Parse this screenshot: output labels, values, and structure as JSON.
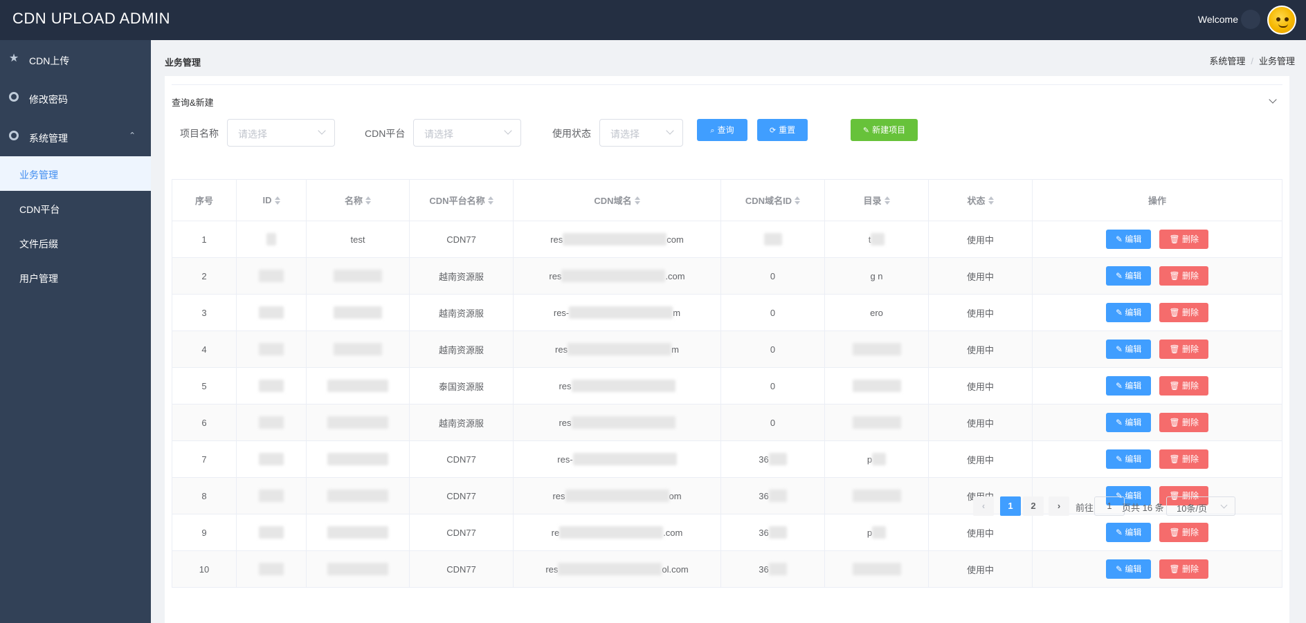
{
  "app": {
    "title": "CDN UPLOAD ADMIN",
    "welcome": "Welcome"
  },
  "sidebar": {
    "items": [
      {
        "label": "CDN上传",
        "icon": "star-icon"
      },
      {
        "label": "修改密码",
        "icon": "settings-icon"
      },
      {
        "label": "系统管理",
        "icon": "settings-icon"
      }
    ],
    "sub_items": [
      {
        "label": "业务管理",
        "active": true
      },
      {
        "label": "CDN平台",
        "active": false
      },
      {
        "label": "文件后缀",
        "active": false
      },
      {
        "label": "用户管理",
        "active": false
      }
    ]
  },
  "page": {
    "title": "业务管理",
    "breadcrumb": [
      "系统管理",
      "/",
      "业务管理"
    ]
  },
  "filter": {
    "panel_title": "查询&新建",
    "fields": [
      {
        "label": "项目名称",
        "placeholder": "请选择"
      },
      {
        "label": "CDN平台",
        "placeholder": "请选择"
      },
      {
        "label": "使用状态",
        "placeholder": "请选择"
      }
    ],
    "buttons": {
      "query": "查询",
      "reset": "重置",
      "create": "新建项目"
    }
  },
  "table": {
    "columns": [
      "序号",
      "ID",
      "名称",
      "CDN平台名称",
      "CDN域名",
      "CDN域名ID",
      "目录",
      "状态",
      "操作"
    ],
    "rows": [
      {
        "no": "1",
        "name": "test",
        "platform": "CDN77",
        "domain_start": "res",
        "domain_end": "com",
        "domain_id": "",
        "dir": "t",
        "status": "使用中"
      },
      {
        "no": "2",
        "name": "",
        "platform": "越南资源服",
        "domain_start": "res",
        "domain_end": ".com",
        "domain_id": "0",
        "dir": "g  n",
        "status": "使用中"
      },
      {
        "no": "3",
        "name": "",
        "platform": "越南资源服",
        "domain_start": "res-",
        "domain_end": "m",
        "domain_id": "0",
        "dir": "ero",
        "status": "使用中"
      },
      {
        "no": "4",
        "name": "",
        "platform": "越南资源服",
        "domain_start": "res",
        "domain_end": "m",
        "domain_id": "0",
        "dir": "",
        "status": "使用中"
      },
      {
        "no": "5",
        "name": "",
        "platform": "泰国资源服",
        "domain_start": "res",
        "domain_end": "",
        "domain_id": "0",
        "dir": "",
        "status": "使用中"
      },
      {
        "no": "6",
        "name": "",
        "platform": "越南资源服",
        "domain_start": "res",
        "domain_end": "",
        "domain_id": "0",
        "dir": "",
        "status": "使用中"
      },
      {
        "no": "7",
        "name": "",
        "platform": "CDN77",
        "domain_start": "res-",
        "domain_end": "",
        "domain_id": "36",
        "dir": "p",
        "status": "使用中"
      },
      {
        "no": "8",
        "name": "",
        "platform": "CDN77",
        "domain_start": "res",
        "domain_end": "om",
        "domain_id": "36",
        "dir": "",
        "status": "使用中"
      },
      {
        "no": "9",
        "name": "",
        "platform": "CDN77",
        "domain_start": "re",
        "domain_end": ".com",
        "domain_id": "36",
        "dir": "p",
        "status": "使用中"
      },
      {
        "no": "10",
        "name": "",
        "platform": "CDN77",
        "domain_start": "res",
        "domain_end": "ol.com",
        "domain_id": "36",
        "dir": "",
        "status": "使用中"
      }
    ],
    "actions": {
      "edit": "编辑",
      "delete": "删除"
    }
  },
  "pagination": {
    "pages": [
      "1",
      "2"
    ],
    "current": "1",
    "goto_label": "前往",
    "goto_value": "1",
    "total_text": "页共 16 条",
    "page_size": "10条/页"
  },
  "colors": {
    "header_bg": "#242f42",
    "sidebar_bg": "#324157",
    "primary": "#409eff",
    "success": "#67c23a",
    "danger": "#f56c6c"
  }
}
